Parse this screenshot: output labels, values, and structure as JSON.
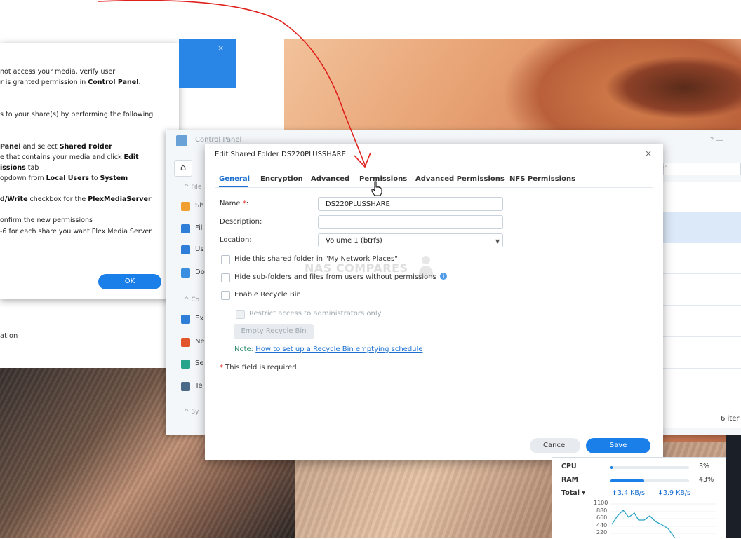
{
  "plex_dialog": {
    "close_icon": "×",
    "lines": [
      {
        "pre": "not access your media, verify user",
        "bold": "",
        "post": ""
      },
      {
        "pre": "",
        "bold": "r",
        "post": " is granted permission in ",
        "bold2": "Control Panel",
        "post2": "."
      },
      {
        "pre": "s to your share(s) by performing the following",
        "bold": "",
        "post": ""
      },
      {
        "pre": "",
        "bold": "Panel",
        "post": " and select ",
        "bold2": "Shared Folder",
        "post2": ""
      },
      {
        "pre": "e that contains your media and click ",
        "bold": "Edit",
        "post": ""
      },
      {
        "pre": "",
        "bold": "issions",
        "post": " tab"
      },
      {
        "pre": "opdown from ",
        "bold": "Local Users",
        "post": " to ",
        "bold2": "System",
        "post2": ""
      },
      {
        "pre": "",
        "bold": "d/Write",
        "post": " checkbox for the ",
        "bold2": "PlexMediaServer",
        "post2": ""
      },
      {
        "pre": "onfirm the new permissions",
        "bold": "",
        "post": ""
      },
      {
        "pre": "-6 for each share you want Plex Media Server",
        "bold": "",
        "post": ""
      }
    ],
    "ok_label": "OK",
    "below_text": "ation"
  },
  "control_panel": {
    "title": "Control Panel",
    "header_controls": "?   —",
    "search_fragment": "er",
    "home_icon": "⌂",
    "sidebar": [
      {
        "label": "File",
        "collapsed": true,
        "color": ""
      },
      {
        "label": "Sh",
        "color": "#f0a030"
      },
      {
        "label": "Fil",
        "color": "#2f7fd8"
      },
      {
        "label": "Us",
        "color": "#2f7fd8"
      },
      {
        "label": "Do",
        "color": "#3a8ee0"
      },
      {
        "label": "Co",
        "collapsed": true,
        "color": ""
      },
      {
        "label": "Ex",
        "color": "#2f7fd8"
      },
      {
        "label": "Ne",
        "color": "#e2552c"
      },
      {
        "label": "Se",
        "color": "#27a58a"
      },
      {
        "label": "Te",
        "color": "#4a6a8a"
      },
      {
        "label": "Sy",
        "collapsed": true,
        "color": ""
      }
    ],
    "items_count": "6 iter"
  },
  "dialog": {
    "title": "Edit Shared Folder DS220PLUSSHARE",
    "close_icon": "×",
    "tabs": [
      "General",
      "Encryption",
      "Advanced",
      "Permissions",
      "Advanced Permissions",
      "NFS Permissions"
    ],
    "active_tab": "General",
    "fields": {
      "name_label": "Name ",
      "name_required_mark": "*",
      "name_colon": ":",
      "name_value": "DS220PLUSSHARE",
      "description_label": "Description:",
      "description_value": "",
      "location_label": "Location:",
      "location_value": "Volume 1 (btrfs)"
    },
    "checkboxes": {
      "hide_folder": "Hide this shared folder in \"My Network Places\"",
      "hide_subfolders": "Hide sub-folders and files from users without permissions",
      "recycle_bin": "Enable Recycle Bin",
      "restrict_admins": "Restrict access to administrators only"
    },
    "empty_recycle_label": "Empty Recycle Bin",
    "note_prefix": "Note: ",
    "note_link": "How to set up a Recycle Bin emptying schedule",
    "required_note": " This field is required.",
    "required_mark": "*",
    "cancel_label": "Cancel",
    "save_label": "Save",
    "watermark": "NAS COMPARES"
  },
  "resource_monitor": {
    "cpu_label": "CPU",
    "cpu_value": "3%",
    "cpu_fraction": 0.03,
    "ram_label": "RAM",
    "ram_value": "43%",
    "ram_fraction": 0.43,
    "total_label": "Total ▾",
    "upload": "3.4 KB/s",
    "download": "3.9 KB/s",
    "y_ticks": [
      "1100",
      "880",
      "660",
      "440",
      "220"
    ]
  },
  "colors": {
    "accent": "#1a7fe8",
    "annotation_arrow": "#e0201c"
  }
}
